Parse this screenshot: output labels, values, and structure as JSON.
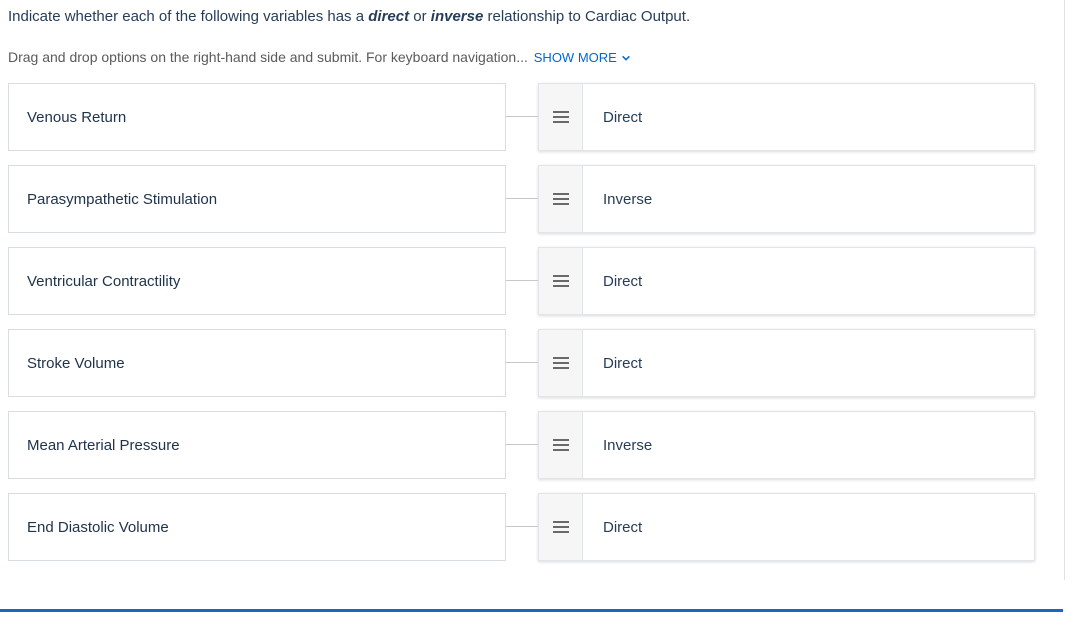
{
  "question": {
    "before": "Indicate whether each of the following variables has a ",
    "em1": "direct",
    "mid": " or ",
    "em2": "inverse",
    "after": " relationship to Cardiac Output."
  },
  "instructions": "Drag and drop options on the right-hand side and submit. For keyboard navigation...",
  "show_more_label": "SHOW MORE",
  "rows": [
    {
      "prompt": "Venous Return",
      "answer": "Direct"
    },
    {
      "prompt": "Parasympathetic Stimulation",
      "answer": "Inverse"
    },
    {
      "prompt": "Ventricular Contractility",
      "answer": "Direct"
    },
    {
      "prompt": "Stroke Volume",
      "answer": "Direct"
    },
    {
      "prompt": "Mean Arterial Pressure",
      "answer": "Inverse"
    },
    {
      "prompt": "End Diastolic Volume",
      "answer": "Direct"
    }
  ]
}
